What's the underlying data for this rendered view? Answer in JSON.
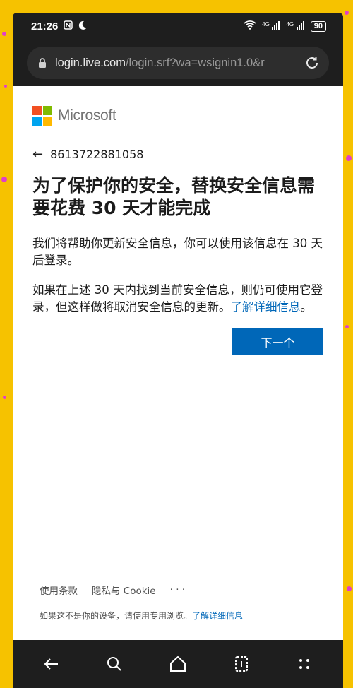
{
  "statusbar": {
    "time": "21:26",
    "nfc_icon": "nfc-icon",
    "moon_icon": "moon-icon",
    "wifi_icon": "wifi-icon",
    "signal1": "4G",
    "signal2": "4G",
    "battery": "90"
  },
  "browser": {
    "url_host": "login.live.com",
    "url_path": "/login.srf?wa=wsignin1.0&r",
    "lock_icon": "lock-icon",
    "reload_icon": "reload-icon"
  },
  "page": {
    "brand": "Microsoft",
    "identity": "8613722881058",
    "headline": "为了保护你的安全，替换安全信息需要花费 30 天才能完成",
    "para1": "我们将帮助你更新安全信息，你可以使用该信息在 30 天后登录。",
    "para2_text": "如果在上述 30 天内找到当前安全信息，则仍可使用它登录，但这样做将取消安全信息的更新。",
    "para2_link": "了解详细信息",
    "para2_end": "。",
    "next_button": "下一个"
  },
  "footer": {
    "terms": "使用条款",
    "privacy": "隐私与 Cookie",
    "more": "· · ·",
    "note_text": "如果这不是你的设备，请使用专用浏览。",
    "note_link": "了解详细信息"
  },
  "colors": {
    "accent": "#0067b8",
    "ms_red": "#f25022",
    "ms_green": "#7fba00",
    "ms_blue": "#00a4ef",
    "ms_yellow": "#ffb900"
  }
}
